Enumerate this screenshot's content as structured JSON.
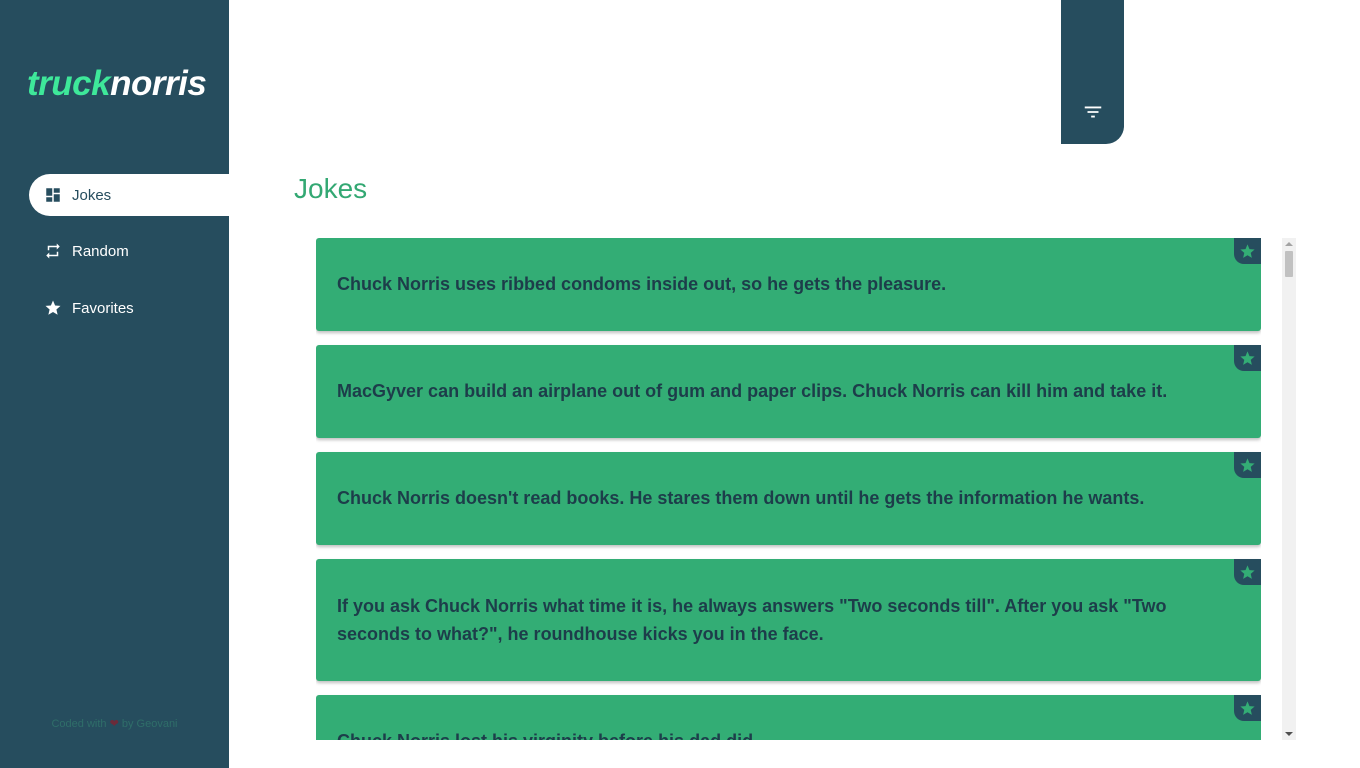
{
  "brand": {
    "part1": "truck",
    "part2": "norris"
  },
  "nav": {
    "items": [
      {
        "label": "Jokes",
        "icon": "dashboard-icon",
        "active": true
      },
      {
        "label": "Random",
        "icon": "repeat-icon",
        "active": false
      },
      {
        "label": "Favorites",
        "icon": "star-icon",
        "active": false
      }
    ]
  },
  "footer": {
    "prefix": "Coded with",
    "heart": "❤",
    "suffix": "by Geovani"
  },
  "filter": {
    "icon": "filter-icon"
  },
  "main": {
    "title": "Jokes"
  },
  "jokes": [
    {
      "text": "Chuck Norris uses ribbed condoms inside out, so he gets the pleasure."
    },
    {
      "text": "MacGyver can build an airplane out of gum and paper clips. Chuck Norris can kill him and take it."
    },
    {
      "text": "Chuck Norris doesn't read books. He stares them down until he gets the information he wants."
    },
    {
      "text": "If you ask Chuck Norris what time it is, he always answers \"Two seconds till\". After you ask \"Two seconds to what?\", he roundhouse kicks you in the face."
    },
    {
      "text": "Chuck Norris lost his virginity before his dad did."
    }
  ],
  "colors": {
    "sidebar": "#264d5e",
    "accent": "#33ad75",
    "brand_green": "#3ee89a",
    "card_text": "#1d3d4a"
  }
}
